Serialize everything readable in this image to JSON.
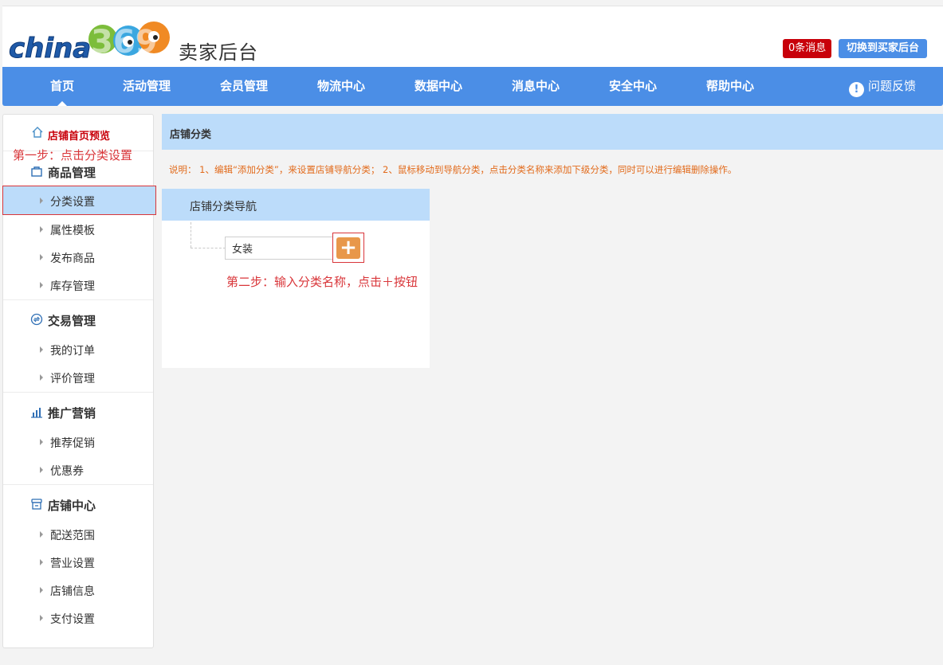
{
  "header": {
    "logo_text": "china369",
    "title": "卖家后台",
    "messages_label": "0条消息",
    "switch_label": "切换到买家后台"
  },
  "nav": {
    "items": [
      {
        "label": "首页",
        "active": true
      },
      {
        "label": "活动管理"
      },
      {
        "label": "会员管理"
      },
      {
        "label": "物流中心"
      },
      {
        "label": "数据中心"
      },
      {
        "label": "消息中心"
      },
      {
        "label": "安全中心"
      },
      {
        "label": "帮助中心"
      }
    ],
    "feedback_label": "问题反馈"
  },
  "sidebar": {
    "home_label": "店铺首页预览",
    "step1_annotation": "第一步：点击分类设置",
    "groups": [
      {
        "title": "商品管理",
        "icon": "bag-icon",
        "items": [
          "分类设置",
          "属性模板",
          "发布商品",
          "库存管理"
        ],
        "selected_item": "分类设置"
      },
      {
        "title": "交易管理",
        "icon": "exchange-icon",
        "items": [
          "我的订单",
          "评价管理"
        ]
      },
      {
        "title": "推广营销",
        "icon": "bar-chart-icon",
        "items": [
          "推荐促销",
          "优惠券"
        ]
      },
      {
        "title": "店铺中心",
        "icon": "store-icon",
        "items": [
          "配送范围",
          "营业设置",
          "店铺信息",
          "支付设置"
        ]
      }
    ]
  },
  "main": {
    "panel_title": "店铺分类",
    "description": "说明： 1、编辑“添加分类”，来设置店铺导航分类； 2、鼠标移动到导航分类，点击分类名称来添加下级分类，同时可以进行编辑删除操作。",
    "box_title": "店铺分类导航",
    "category_input_value": "女装",
    "add_button_label": "+",
    "step2_annotation": "第二步：输入分类名称，点击＋按钮"
  },
  "colors": {
    "brand_blue": "#4b8ee6",
    "light_blue": "#bcdcfa",
    "alert_red": "#c8000a",
    "annotation_red": "#d9363a",
    "add_orange": "#e8974a",
    "desc_orange": "#e26b1c"
  }
}
